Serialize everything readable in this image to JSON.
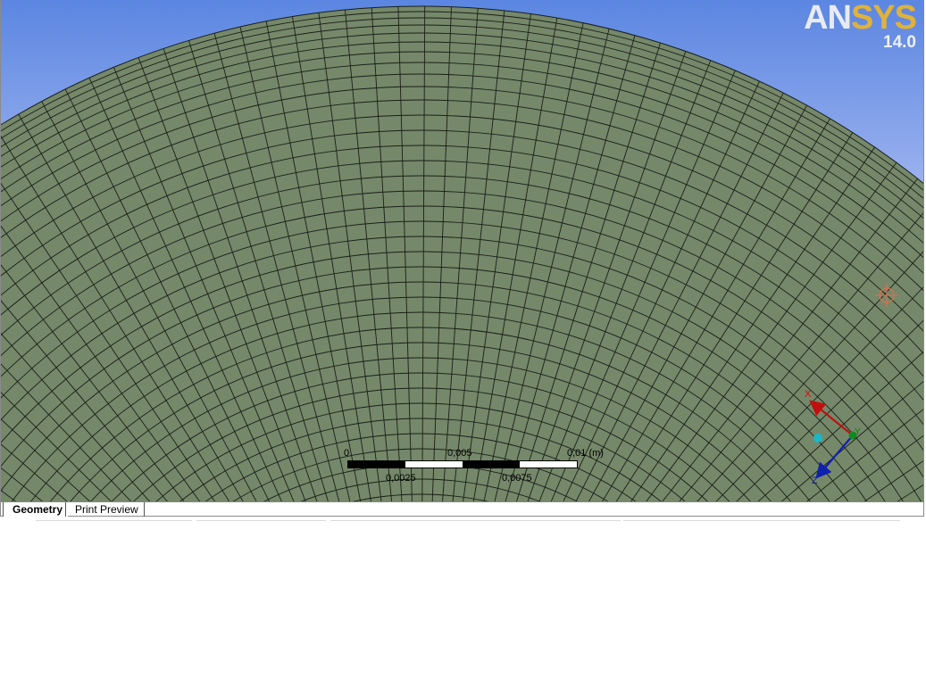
{
  "logo": {
    "brand_a": "AN",
    "brand_b": "SYS",
    "version": "14.0"
  },
  "scale_bar": {
    "unit": "(m)",
    "top_labels": [
      "0",
      "0,005",
      "0,01 (m)"
    ],
    "bottom_labels": [
      "0,0025",
      "0,0075"
    ]
  },
  "triad": {
    "x_label": "X",
    "y_label": "Y",
    "z_label": "Z"
  },
  "tabs": [
    {
      "label": "Geometry",
      "active": true
    },
    {
      "label": "Print Preview",
      "active": false
    }
  ],
  "colors": {
    "mesh_fill": "#75886a",
    "mesh_line": "#1a1f17",
    "x_axis": "#c01010",
    "y_axis": "#108010",
    "z_axis": "#1020b0",
    "accent_logo": "#e0b23a"
  }
}
